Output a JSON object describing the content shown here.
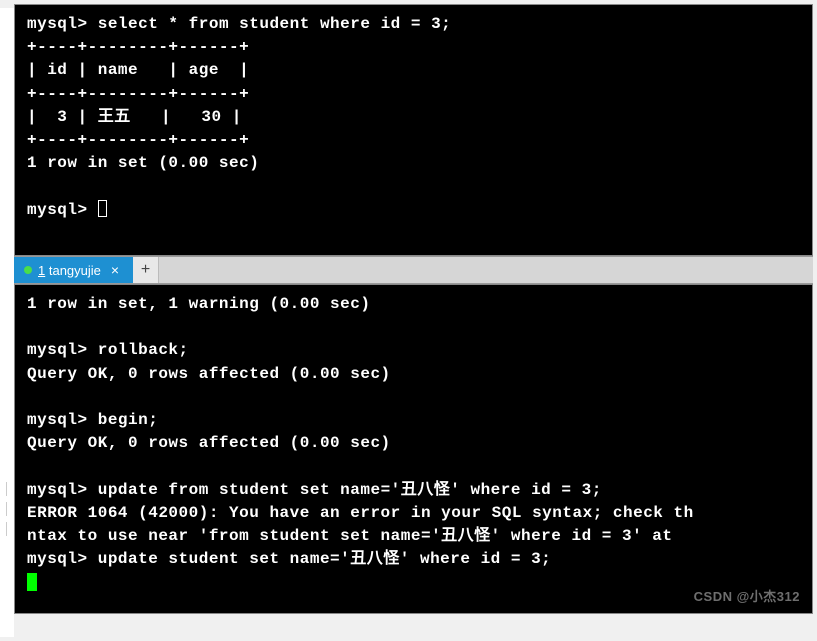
{
  "top_terminal": {
    "prompt": "mysql>",
    "query": "select * from student where id = 3;",
    "table_border_top": "+----+--------+------+",
    "table_header": "| id | name   | age  |",
    "table_border_mid": "+----+--------+------+",
    "table_row": "|  3 | 王五   |   30 |",
    "table_border_bot": "+----+--------+------+",
    "result_msg": "1 row in set (0.00 sec)",
    "prompt2": "mysql>"
  },
  "tabs": {
    "active_num": "1",
    "active_label": "tangyujie",
    "close_glyph": "×",
    "add_glyph": "+"
  },
  "bottom_terminal": {
    "line1": "1 row in set, 1 warning (0.00 sec)",
    "prompt": "mysql>",
    "cmd_rollback": "rollback;",
    "ok_rollback": "Query OK, 0 rows affected (0.00 sec)",
    "cmd_begin": "begin;",
    "ok_begin": "Query OK, 0 rows affected (0.00 sec)",
    "cmd_update_err": "update from student set name='丑八怪' where id = 3;",
    "error_line1": "ERROR 1064 (42000): You have an error in your SQL syntax; check th",
    "error_line2": "ntax to use near 'from student set name='丑八怪' where id = 3' at ",
    "cmd_update_ok": "update student set name='丑八怪' where id = 3;"
  },
  "watermark": "CSDN @小杰312"
}
